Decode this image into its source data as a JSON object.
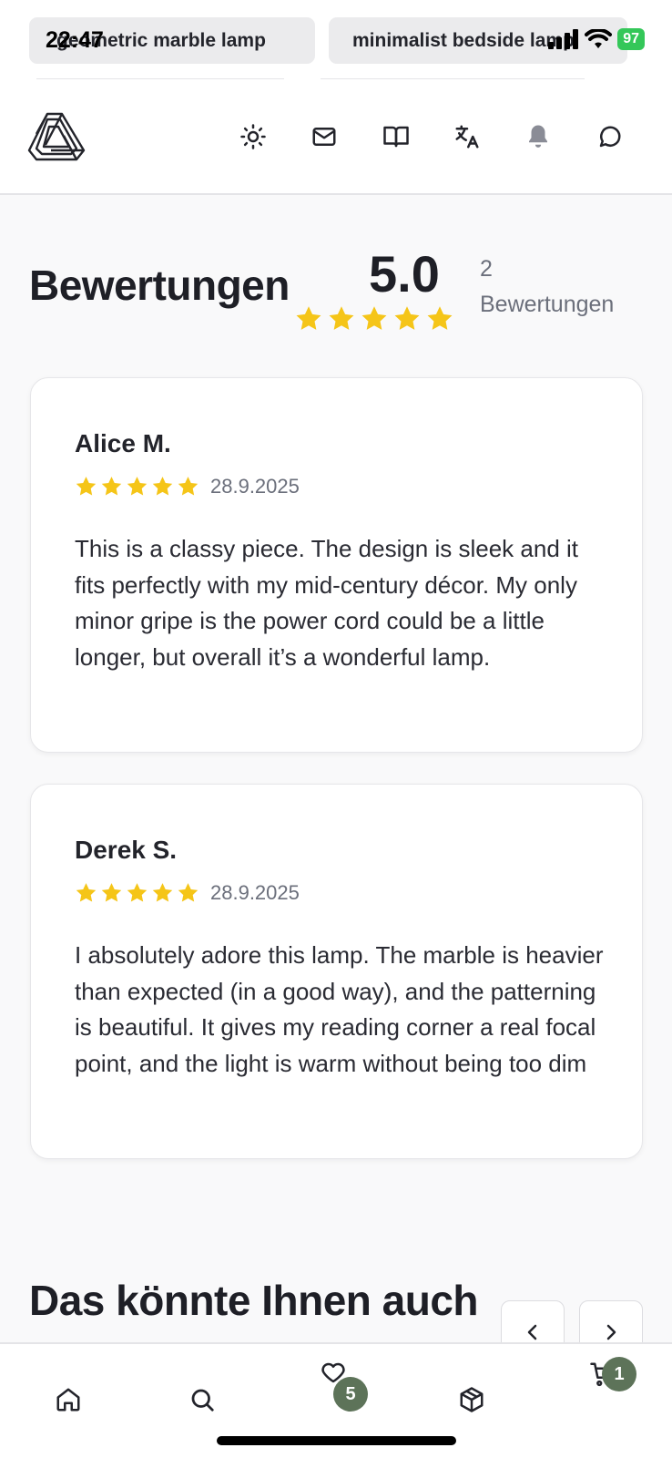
{
  "status_bar": {
    "time": "22:47",
    "battery": "97"
  },
  "top_chips": [
    {
      "label": "geometric marble lamp"
    },
    {
      "label": "minimalist bedside lamp"
    }
  ],
  "header": {
    "icons": [
      "theme-sun-icon",
      "mail-icon",
      "book-icon",
      "translate-icon",
      "bell-icon",
      "chat-icon"
    ]
  },
  "reviews": {
    "title": "Bewertungen",
    "average": "5.0",
    "count": "2",
    "count_label": "Bewertungen",
    "star_color": "#f5c518",
    "items": [
      {
        "name": "Alice M.",
        "rating": 5,
        "date": "28.9.2025",
        "text": "This is a classy piece. The design is sleek and it fits perfectly with my mid-century décor. My only minor gripe is the power cord could be a little longer, but overall it’s a wonderful lamp."
      },
      {
        "name": "Derek S.",
        "rating": 5,
        "date": "28.9.2025",
        "text": "I absolutely adore this lamp. The marble is heavier than expected (in a good way), and the patterning is beautiful. It gives my reading corner a real focal point, and the light is warm without being too dim"
      }
    ]
  },
  "recommendations": {
    "title": "Das könnte Ihnen auch"
  },
  "bottom_nav": {
    "wishlist_count": "5",
    "cart_count": "1",
    "badge_color": "#5d7359"
  }
}
